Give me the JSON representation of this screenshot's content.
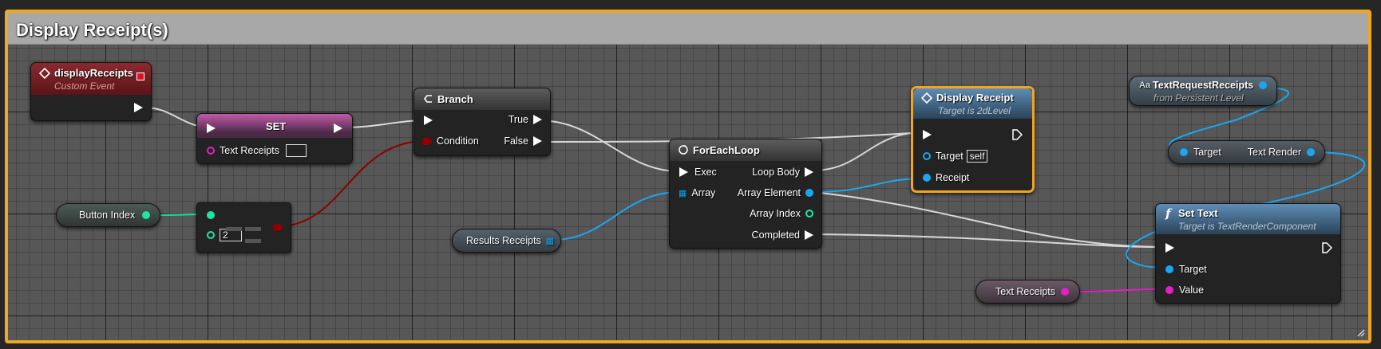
{
  "comment": {
    "title": "Display Receipt(s)"
  },
  "colors": {
    "accent": "#f0a623",
    "exec": "#ffffff",
    "integer": "#1de5a0",
    "boolean": "#8c0000",
    "text": "#e31fc8",
    "object": "#1aa7f1",
    "event_header": "#7a1f24",
    "set_header": "#b43fa0",
    "function_header": "#3a6e96"
  },
  "nodes": {
    "display_receipts": {
      "title": "displayReceipts",
      "subtitle": "Custom Event",
      "icon": "event-diamond-icon"
    },
    "set": {
      "title": "SET",
      "pin_text_receipts": "Text Receipts",
      "value": ""
    },
    "button_index": {
      "label": "Button Index"
    },
    "equal_int": {
      "value": "2",
      "symbol": "equal-operator-icon"
    },
    "branch": {
      "title": "Branch",
      "icon": "branch-icon",
      "true_label": "True",
      "false_label": "False",
      "condition_label": "Condition"
    },
    "results_receipts": {
      "label": "Results Receipts",
      "icon": "array-grid-icon"
    },
    "for_each_loop": {
      "title": "ForEachLoop",
      "icon": "loop-icon",
      "exec_label": "Exec",
      "array_label": "Array",
      "loop_body_label": "Loop Body",
      "array_element_label": "Array Element",
      "array_index_label": "Array Index",
      "completed_label": "Completed"
    },
    "display_receipt": {
      "title": "Display Receipt",
      "subtitle": "Target is 2dLevel",
      "icon": "event-diamond-icon",
      "target_label": "Target",
      "target_value": "self",
      "receipt_label": "Receipt"
    },
    "text_request_receipts": {
      "title": "TextRequestReceipts",
      "subtitle": "from Persistent Level",
      "icon": "text-render-icon"
    },
    "get_text_render": {
      "target_label": "Target",
      "output_label": "Text Render"
    },
    "set_text": {
      "title": "Set Text",
      "subtitle": "Target is TextRenderComponent",
      "icon": "function-icon",
      "target_label": "Target",
      "value_label": "Value"
    },
    "text_receipts_getter": {
      "label": "Text Receipts"
    }
  }
}
